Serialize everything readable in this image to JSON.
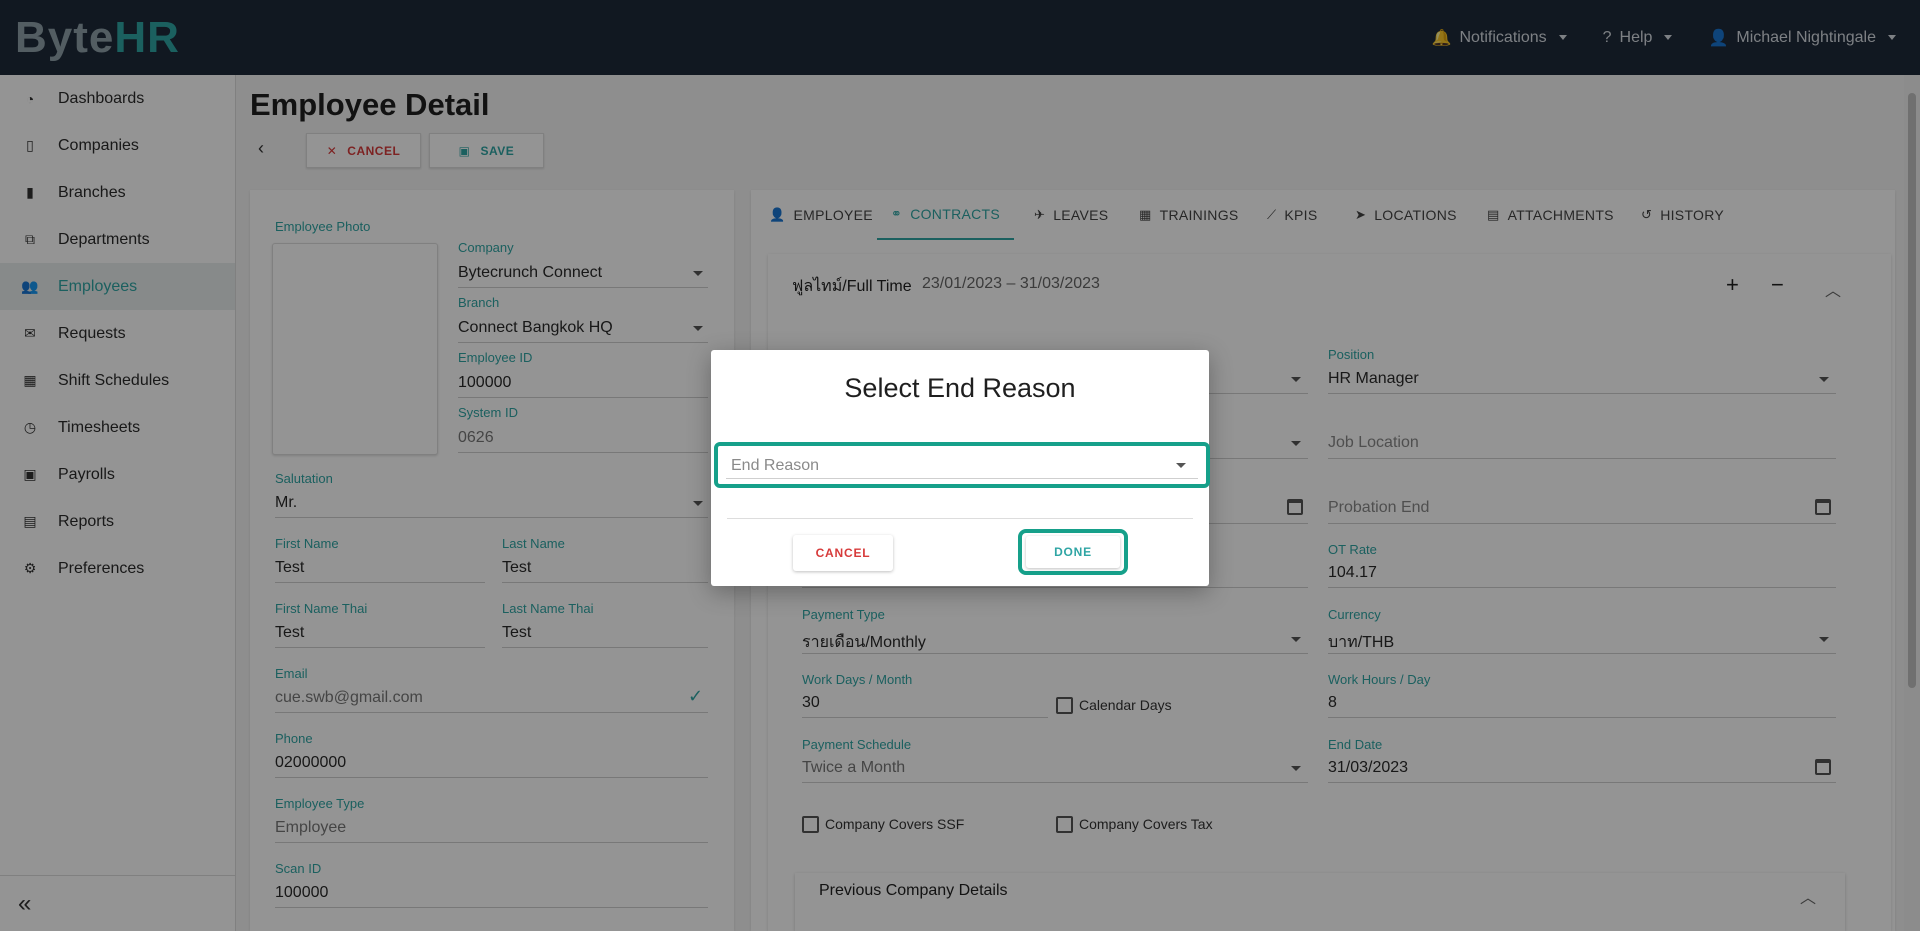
{
  "app": {
    "logo_prefix": "By",
    "logo_mid": "te",
    "logo_suffix": "HR"
  },
  "topbar": {
    "notifications": "Notifications",
    "help": "Help",
    "user": "Michael Nightingale"
  },
  "sidebar": {
    "items": [
      {
        "label": "Dashboards",
        "icon": "gauge-icon"
      },
      {
        "label": "Companies",
        "icon": "building-icon"
      },
      {
        "label": "Branches",
        "icon": "office-icon"
      },
      {
        "label": "Departments",
        "icon": "org-chart-icon"
      },
      {
        "label": "Employees",
        "icon": "users-icon",
        "active": true
      },
      {
        "label": "Requests",
        "icon": "envelope-icon"
      },
      {
        "label": "Shift Schedules",
        "icon": "calendar-icon"
      },
      {
        "label": "Timesheets",
        "icon": "clock-icon"
      },
      {
        "label": "Payrolls",
        "icon": "money-icon"
      },
      {
        "label": "Reports",
        "icon": "document-icon"
      },
      {
        "label": "Preferences",
        "icon": "gears-icon"
      }
    ]
  },
  "page": {
    "title": "Employee Detail",
    "cancel_label": "CANCEL",
    "save_label": "SAVE"
  },
  "employee": {
    "photo_label": "Employee Photo",
    "company_label": "Company",
    "company": "Bytecrunch Connect",
    "branch_label": "Branch",
    "branch": "Connect Bangkok HQ",
    "employee_id_label": "Employee ID",
    "employee_id": "100000",
    "system_id_label": "System ID",
    "system_id": "0626",
    "salutation_label": "Salutation",
    "salutation": "Mr.",
    "first_name_label": "First Name",
    "first_name": "Test",
    "last_name_label": "Last Name",
    "last_name": "Test",
    "first_name_thai_label": "First Name Thai",
    "first_name_thai": "Test",
    "last_name_thai_label": "Last Name Thai",
    "last_name_thai": "Test",
    "email_label": "Email",
    "email": "cue.swb@gmail.com",
    "phone_label": "Phone",
    "phone": "02000000",
    "employee_type_label": "Employee Type",
    "employee_type": "Employee",
    "scan_id_label": "Scan ID",
    "scan_id": "100000"
  },
  "tabs": [
    {
      "label": "EMPLOYEE",
      "icon": "user-icon"
    },
    {
      "label": "CONTRACTS",
      "icon": "handshake-icon",
      "active": true
    },
    {
      "label": "LEAVES",
      "icon": "plane-icon"
    },
    {
      "label": "TRAININGS",
      "icon": "calendar-icon"
    },
    {
      "label": "KPIS",
      "icon": "line-chart-icon"
    },
    {
      "label": "LOCATIONS",
      "icon": "location-arrow-icon"
    },
    {
      "label": "ATTACHMENTS",
      "icon": "file-icon"
    },
    {
      "label": "HISTORY",
      "icon": "history-icon"
    }
  ],
  "contract": {
    "title": "ฟูลไทม์/Full Time",
    "dates": "23/01/2023 – 31/03/2023",
    "position_label": "Position",
    "position": "HR Manager",
    "job_location_placeholder": "Job Location",
    "probation_end_placeholder": "Probation End",
    "ot_rate_label": "OT Rate",
    "ot_rate": "104.17",
    "payment_type_label": "Payment Type",
    "payment_type": "รายเดือน/Monthly",
    "currency_label": "Currency",
    "currency": "บาท/THB",
    "work_days_label": "Work Days / Month",
    "work_days": "30",
    "calendar_days_label": "Calendar Days",
    "work_hours_label": "Work Hours / Day",
    "work_hours": "8",
    "payment_schedule_label": "Payment Schedule",
    "payment_schedule": "Twice a Month",
    "end_date_label": "End Date",
    "end_date": "31/03/2023",
    "covers_ssf_label": "Company Covers SSF",
    "covers_tax_label": "Company Covers Tax",
    "previous_company_label": "Previous Company Details"
  },
  "dialog": {
    "title": "Select End Reason",
    "field_placeholder": "End Reason",
    "cancel_label": "CANCEL",
    "done_label": "DONE"
  },
  "colors": {
    "accent": "#2fa5a4",
    "danger": "#d73b3b",
    "topbar": "#1e2a3a",
    "highlight": "#16a08a"
  }
}
